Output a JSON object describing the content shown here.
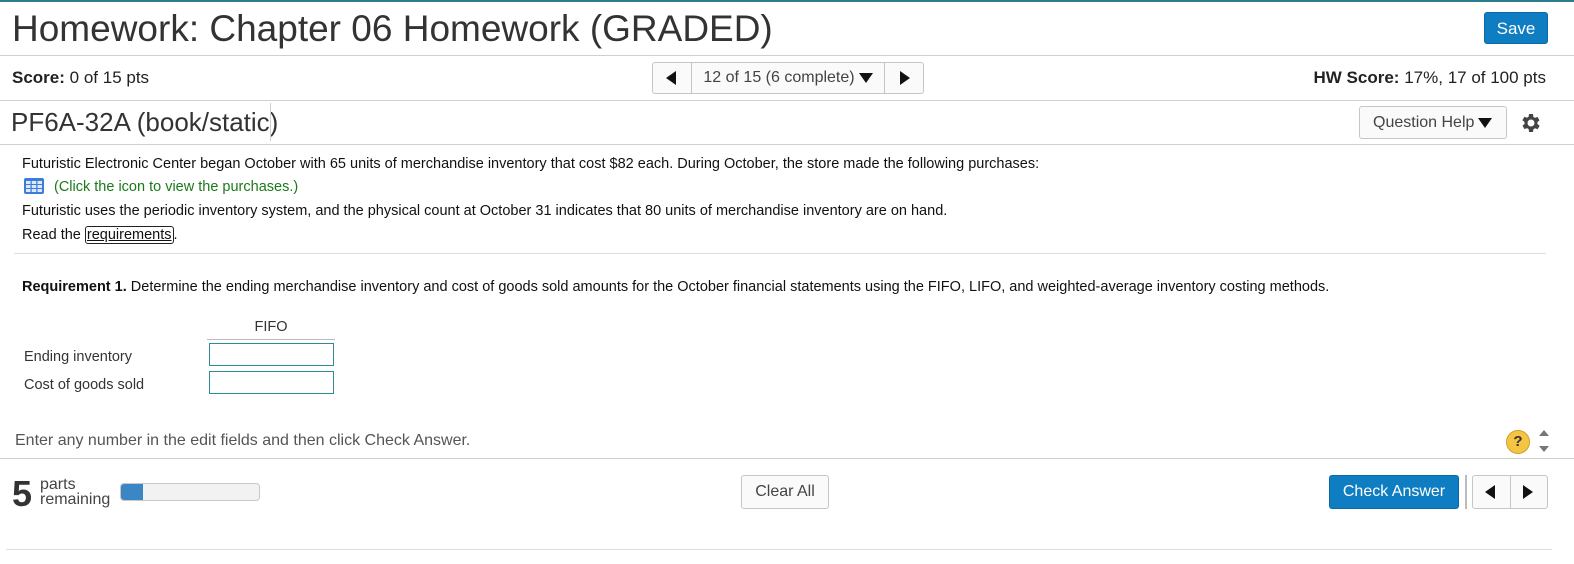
{
  "header": {
    "title": "Homework: Chapter 06 Homework (GRADED)",
    "save_label": "Save"
  },
  "score_bar": {
    "score_label": "Score:",
    "score_value": "0 of 15 pts",
    "nav_label": "12 of 15 (6 complete)",
    "hw_score_label": "HW Score:",
    "hw_score_value": "17%, 17 of 100 pts"
  },
  "question": {
    "id": "PF6A-32A (book/static)",
    "help_label": "Question Help"
  },
  "problem": {
    "line1": "Futuristic Electronic Center began October with 65 units of merchandise inventory that cost $82 each. During October, the store made the following purchases:",
    "icon_link": "(Click the icon to view the purchases.)",
    "line2": "Futuristic uses the periodic inventory system, and the physical count at October 31 indicates that 80 units of merchandise inventory are on hand.",
    "read_prefix": "Read the ",
    "requirements_link": "requirements",
    "read_suffix": "."
  },
  "requirement": {
    "label": "Requirement 1.",
    "text": " Determine the ending merchandise inventory and cost of goods sold amounts for the October financial statements using the FIFO, LIFO, and weighted-average inventory costing methods."
  },
  "table": {
    "column_header": "FIFO",
    "rows": [
      {
        "label": "Ending inventory",
        "value": ""
      },
      {
        "label": "Cost of goods sold",
        "value": ""
      }
    ]
  },
  "hint": "Enter any number in the edit fields and then click Check Answer.",
  "help_symbol": "?",
  "footer": {
    "parts_count": "5",
    "parts_line1": "parts",
    "parts_line2": "remaining",
    "progress_fraction": 0.16,
    "clear_all_label": "Clear All",
    "check_answer_label": "Check Answer"
  },
  "colors": {
    "primary": "#0f7dc2",
    "link_green": "#1a7a1a",
    "input_border": "#2e8b9a",
    "progress_fill": "#3d86c6"
  }
}
